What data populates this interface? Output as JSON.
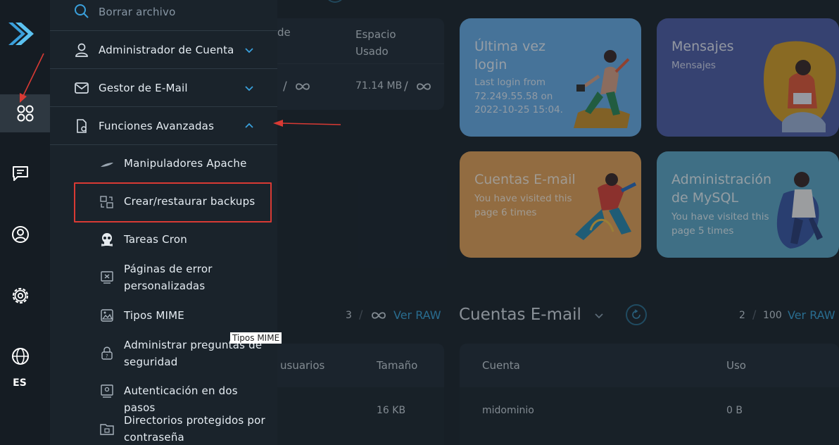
{
  "rail": {
    "language": "ES"
  },
  "menu": {
    "search_label": "Borrar archivo",
    "items": [
      {
        "label": "Administrador de Cuenta"
      },
      {
        "label": "Gestor de E-Mail"
      },
      {
        "label": "Funciones Avanzadas"
      }
    ],
    "subitems": [
      {
        "label": "Manipuladores Apache"
      },
      {
        "label": "Crear/restaurar backups"
      },
      {
        "label": "Tareas Cron"
      },
      {
        "label": "Páginas de error personalizadas"
      },
      {
        "label": "Tipos MIME"
      },
      {
        "label": "Administrar preguntas de seguridad"
      },
      {
        "label": "Autenticación en dos pasos"
      },
      {
        "label": "Directorios protegidos por contraseña"
      }
    ],
    "tooltip": "Tipos MIME"
  },
  "dashboard": {
    "usage_table": {
      "col_partial": "de",
      "col_space": "Espacio Usado",
      "row_slash": "/",
      "row_space": "71.14 MB",
      "row_space_slash": "/"
    },
    "cards": [
      {
        "title": "Última vez login",
        "text": "Last login from 72.249.55.58 on 2022-10-25 15:04.",
        "color": "#6aaee8"
      },
      {
        "title": "Mensajes",
        "text": "Mensajes",
        "color": "#4f5fa8"
      },
      {
        "title": "Cuentas E-mail",
        "text": "You have visited this page 6 times",
        "color": "#e4a45b"
      },
      {
        "title": "Administración de MySQL",
        "text": "You have visited this page 5 times",
        "color": "#5ea8c8"
      }
    ],
    "left_section": {
      "count": "3",
      "slash": "/",
      "raw_link": "Ver RAW",
      "col_users": "e usuarios",
      "col_size": "Tamaño",
      "row_size": "16 KB"
    },
    "email_section": {
      "title": "Cuentas E-mail",
      "count": "2",
      "slash": "/",
      "total": "100",
      "raw_link": "Ver RAW",
      "col_account": "Cuenta",
      "col_usage": "Uso",
      "row_account": "midominio",
      "row_usage": "0 B"
    }
  }
}
